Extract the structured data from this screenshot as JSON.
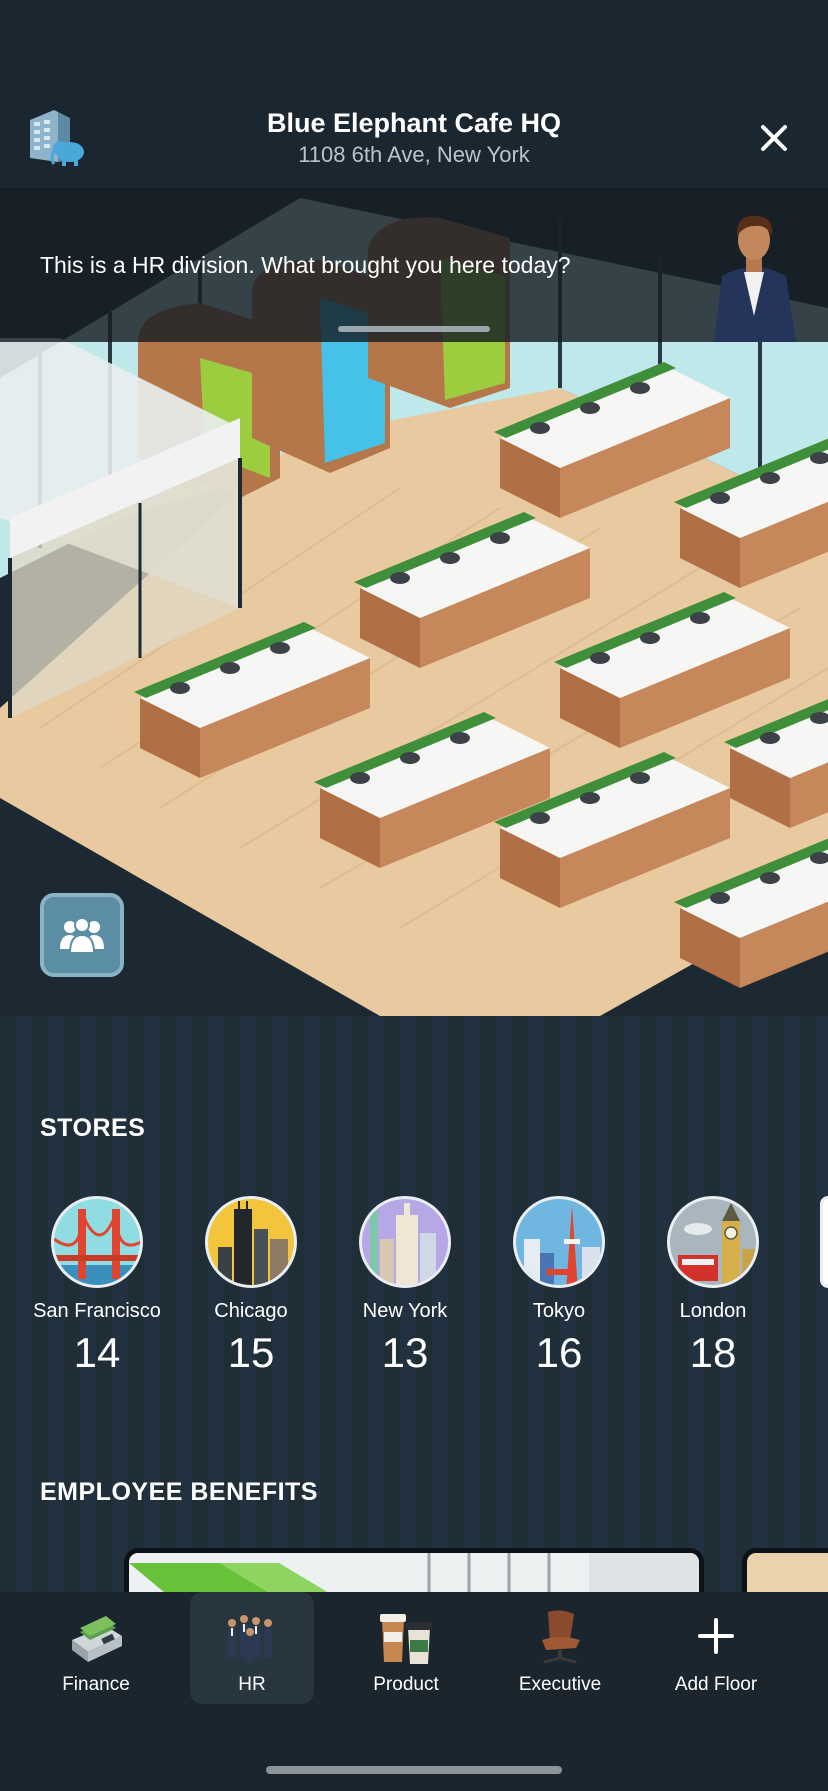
{
  "header": {
    "title": "Blue Elephant Cafe HQ",
    "subtitle": "1108 6th Ave, New York",
    "logo_icon": "building-elephant-icon",
    "close_icon": "close-icon"
  },
  "dialog": {
    "message": "This is a HR division. What brought you here today?",
    "speaker_icon": "hr-manager-avatar"
  },
  "scene": {
    "team_button_icon": "team-icon"
  },
  "stores": {
    "title": "STORES",
    "items": [
      {
        "name": "San Francisco",
        "count": "14",
        "icon": "golden-gate-icon"
      },
      {
        "name": "Chicago",
        "count": "15",
        "icon": "chicago-skyline-icon"
      },
      {
        "name": "New York",
        "count": "13",
        "icon": "new-york-skyline-icon"
      },
      {
        "name": "Tokyo",
        "count": "16",
        "icon": "tokyo-tower-icon"
      },
      {
        "name": "London",
        "count": "18",
        "icon": "big-ben-icon"
      }
    ]
  },
  "benefits": {
    "title": "EMPLOYEE BENEFITS"
  },
  "tabs": [
    {
      "label": "Finance",
      "icon": "cash-counter-icon",
      "active": false
    },
    {
      "label": "HR",
      "icon": "people-group-icon",
      "active": true
    },
    {
      "label": "Product",
      "icon": "coffee-cups-icon",
      "active": false
    },
    {
      "label": "Executive",
      "icon": "office-chair-icon",
      "active": false
    },
    {
      "label": "Add Floor",
      "icon": "plus-icon",
      "active": false
    }
  ],
  "colors": {
    "background": "#1d2a33",
    "floor": "#e8c9a0",
    "accent": "#5b8ea4"
  }
}
